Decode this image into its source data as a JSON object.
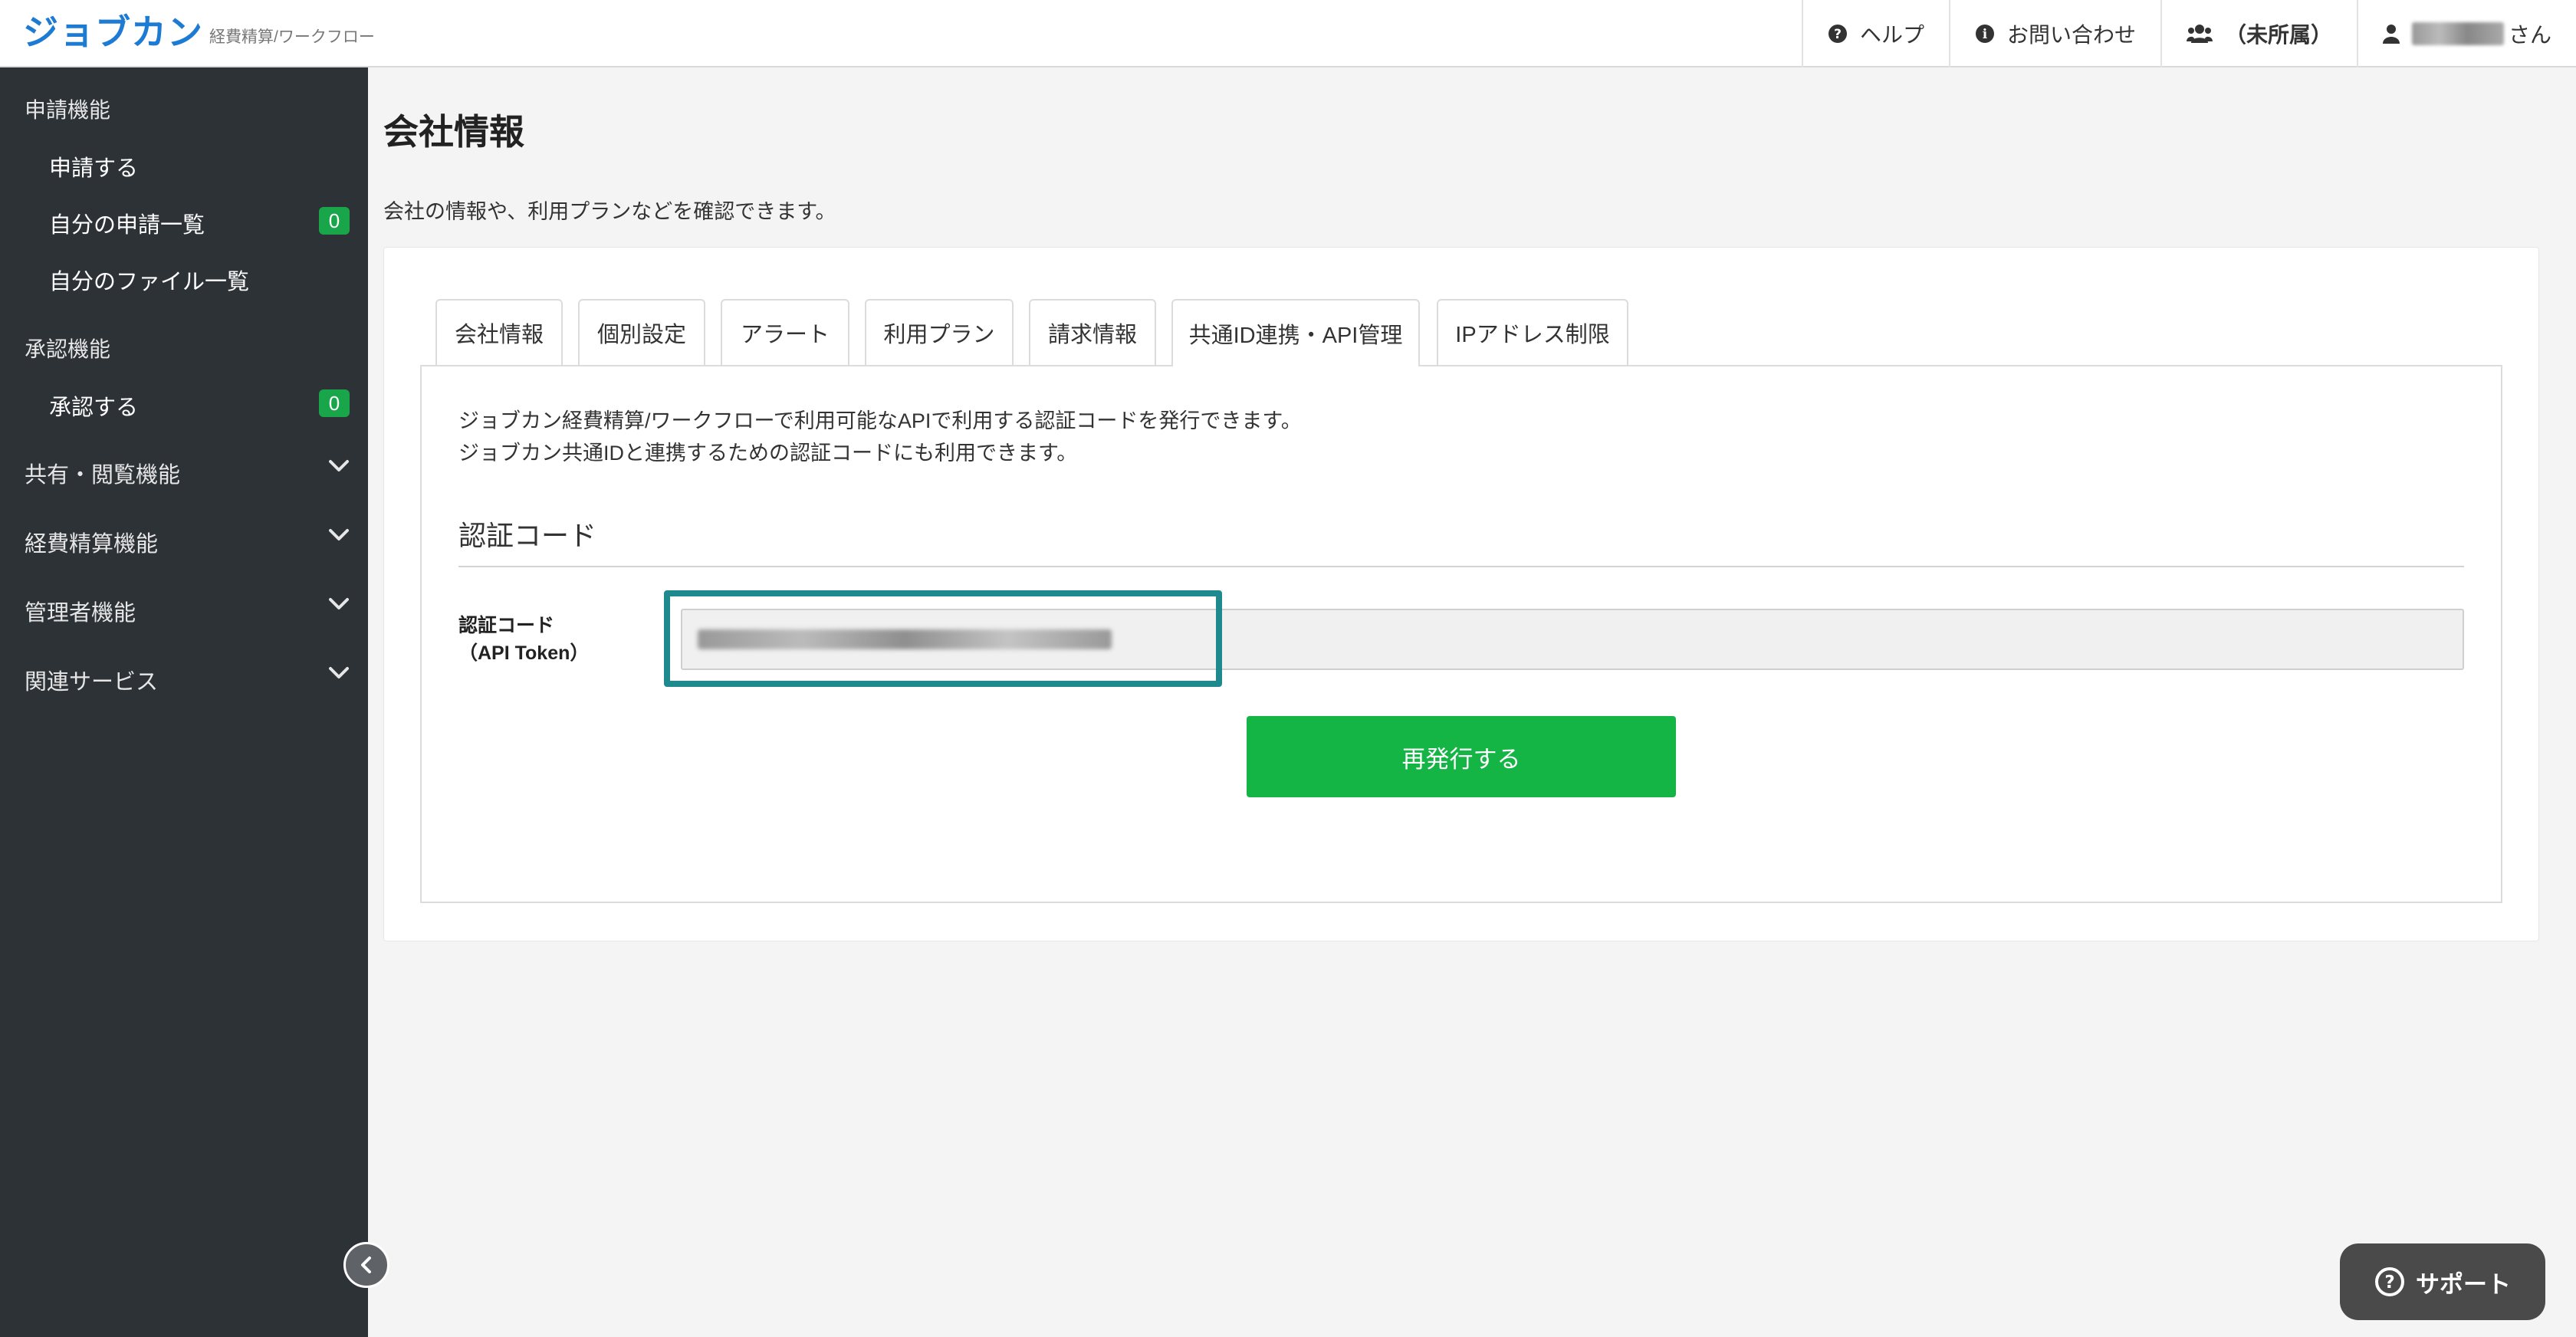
{
  "header": {
    "logo_main": "ジョブカン",
    "logo_sub": "経費精算/ワークフロー",
    "nav": {
      "help": "ヘルプ",
      "contact": "お問い合わせ",
      "group": "（未所属）",
      "user_suffix": "さん"
    }
  },
  "sidebar": {
    "sections": [
      {
        "title": "申請機能",
        "items": [
          {
            "label": "申請する"
          },
          {
            "label": "自分の申請一覧",
            "badge": "0"
          },
          {
            "label": "自分のファイル一覧"
          }
        ]
      },
      {
        "title": "承認機能",
        "items": [
          {
            "label": "承認する",
            "badge": "0"
          }
        ]
      }
    ],
    "groups": [
      "共有・閲覧機能",
      "経費精算機能",
      "管理者機能",
      "関連サービス"
    ]
  },
  "main": {
    "title": "会社情報",
    "description": "会社の情報や、利用プランなどを確認できます。",
    "tabs": [
      {
        "label": "会社情報"
      },
      {
        "label": "個別設定"
      },
      {
        "label": "アラート"
      },
      {
        "label": "利用プラン"
      },
      {
        "label": "請求情報"
      },
      {
        "label": "共通ID連携・API管理",
        "active": true
      },
      {
        "label": "IPアドレス制限"
      }
    ],
    "panel": {
      "desc_line1": "ジョブカン経費精算/ワークフローで利用可能なAPIで利用する認証コードを発行できます。",
      "desc_line2": "ジョブカン共通IDと連携するための認証コードにも利用できます。",
      "section_title": "認証コード",
      "field_label_line1": "認証コード",
      "field_label_line2": "（API Token）",
      "reissue_button": "再発行する"
    }
  },
  "support_button": "サポート",
  "colors": {
    "brand": "#1e7bd4",
    "sidebar_bg": "#2d3237",
    "badge_green": "#19a64a",
    "button_green": "#14b545",
    "highlight": "#1f8a8d"
  }
}
